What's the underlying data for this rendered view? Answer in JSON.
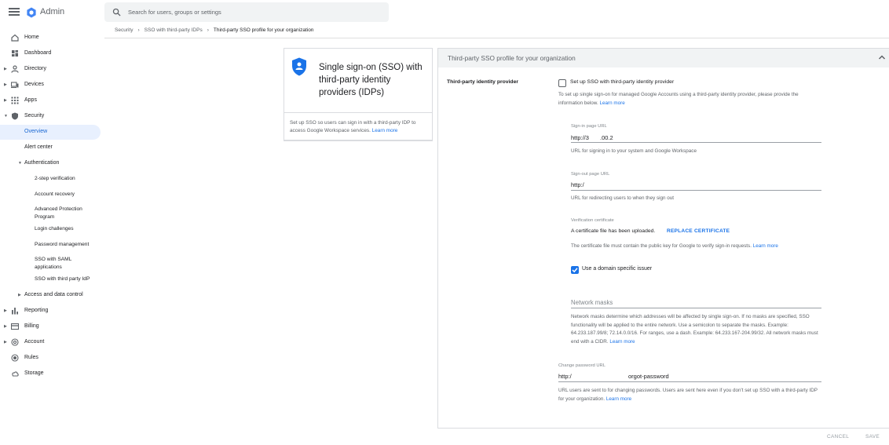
{
  "app": {
    "name": "Admin"
  },
  "search": {
    "placeholder": "Search for users, groups or settings"
  },
  "breadcrumb": [
    "Security",
    "SSO with third-party IDPs",
    "Third-party SSO profile for your organization"
  ],
  "sidebar": {
    "items": [
      {
        "label": "Home",
        "icon": "home-icon"
      },
      {
        "label": "Dashboard",
        "icon": "dashboard-icon"
      },
      {
        "label": "Directory",
        "icon": "person-icon"
      },
      {
        "label": "Devices",
        "icon": "devices-icon"
      },
      {
        "label": "Apps",
        "icon": "apps-grid-icon"
      },
      {
        "label": "Security",
        "icon": "shield-icon"
      },
      {
        "label": "Overview"
      },
      {
        "label": "Alert center"
      },
      {
        "label": "Authentication"
      },
      {
        "label": "2-step verification"
      },
      {
        "label": "Account recovery"
      },
      {
        "label": "Advanced Protection Program"
      },
      {
        "label": "Login challenges"
      },
      {
        "label": "Password management"
      },
      {
        "label": "SSO with SAML applications"
      },
      {
        "label": "SSO with third party IdP"
      },
      {
        "label": "Access and data control"
      },
      {
        "label": "Reporting",
        "icon": "bar-chart-icon"
      },
      {
        "label": "Billing",
        "icon": "credit-card-icon"
      },
      {
        "label": "Account",
        "icon": "at-sign-icon"
      },
      {
        "label": "Rules",
        "icon": "rules-icon"
      },
      {
        "label": "Storage",
        "icon": "cloud-icon"
      }
    ]
  },
  "card": {
    "title": "Single sign-on (SSO) with third-party identity providers (IDPs)",
    "description": "Set up SSO so users can sign in with a third-party IDP to access Google Workspace services.",
    "learn_more": "Learn more"
  },
  "panel": {
    "title": "Third-party SSO profile for your organization",
    "section_label": "Third-party identity provider",
    "setup_checkbox": {
      "label": "Set up SSO with third-party identity provider",
      "checked": false
    },
    "setup_help": "To set up single sign-on for managed Google Accounts using a third-party identity provider, please provide the information below.",
    "learn_more": "Learn more",
    "signin_url": {
      "label": "Sign-in page URL",
      "value": "http://3",
      "value_b": ".00.2",
      "help": "URL for signing in to your system and Google Workspace"
    },
    "signout_url": {
      "label": "Sign-out page URL",
      "value": "http:/",
      "help": "URL for redirecting users to when they sign out"
    },
    "certificate": {
      "label": "Verification certificate",
      "status": "A certificate file has been uploaded.",
      "replace_label": "REPLACE CERTIFICATE",
      "help": "The certificate file must contain the public key for Google to verify sign-in requests."
    },
    "domain_issuer": {
      "label": "Use a domain specific issuer",
      "checked": true
    },
    "network_masks": {
      "placeholder": "Network masks",
      "help": "Network masks determine which addresses will be affected by single sign-on. If no masks are specified, SSO functionality will be applied to the entire network. Use a semicolon to separate the masks. Example: 64.233.187.99/8; 72.14.0.0/16. For ranges, use a dash. Example: 64.233.167-204.99/32. All network masks must end with a CIDR."
    },
    "change_password": {
      "label": "Change password URL",
      "value": "http:/",
      "value_b": "orgot-password",
      "help": "URL users are sent to for changing passwords. Users are sent here even if you don't set up SSO with a third-party IDP for your organization."
    },
    "cancel_label": "CANCEL",
    "save_label": "SAVE"
  },
  "colors": {
    "accent": "#1a73e8",
    "active_bg": "#e8f0fe"
  }
}
